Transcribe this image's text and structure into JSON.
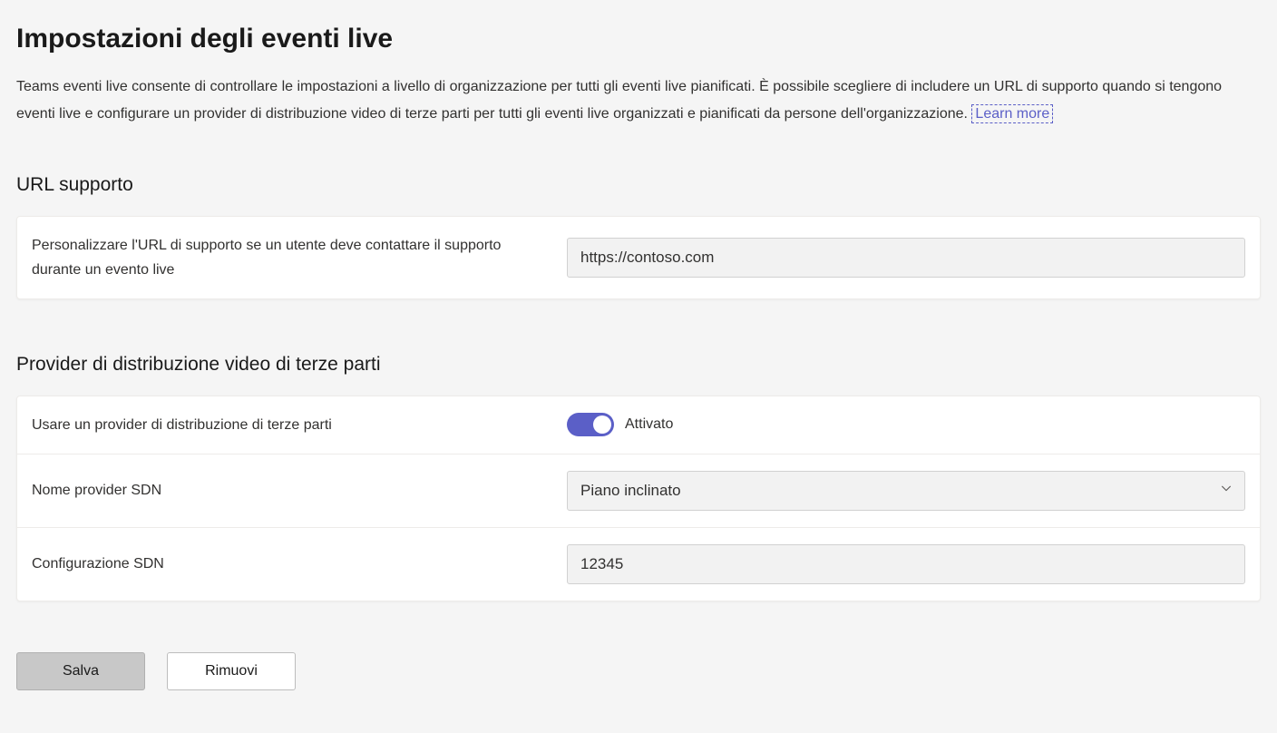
{
  "page": {
    "title": "Impostazioni degli eventi live",
    "intro_main": "Teams eventi live consente di controllare le impostazioni a livello di organizzazione per tutti gli eventi live pianificati. È possibile scegliere di includere un URL di supporto quando si tengono eventi live e configurare un provider di distribuzione video di terze parti per tutti gli eventi live organizzati e pianificati da persone dell'organizzazione. ",
    "learn_more": "Learn more"
  },
  "sections": {
    "support_url": {
      "heading": "URL supporto",
      "label": "Personalizzare l'URL di supporto se un utente deve contattare il supporto durante un evento live",
      "value": "https://contoso.com"
    },
    "third_party": {
      "heading": "Provider di distribuzione video di terze parti",
      "use_provider_label": "Usare un provider di distribuzione di terze parti",
      "toggle_state_label": "Attivato",
      "sdn_name_label": "Nome provider SDN",
      "sdn_name_value": "Piano inclinato",
      "sdn_config_label": "Configurazione SDN",
      "sdn_config_value": "12345"
    }
  },
  "buttons": {
    "save": "Salva",
    "discard": "Rimuovi"
  }
}
